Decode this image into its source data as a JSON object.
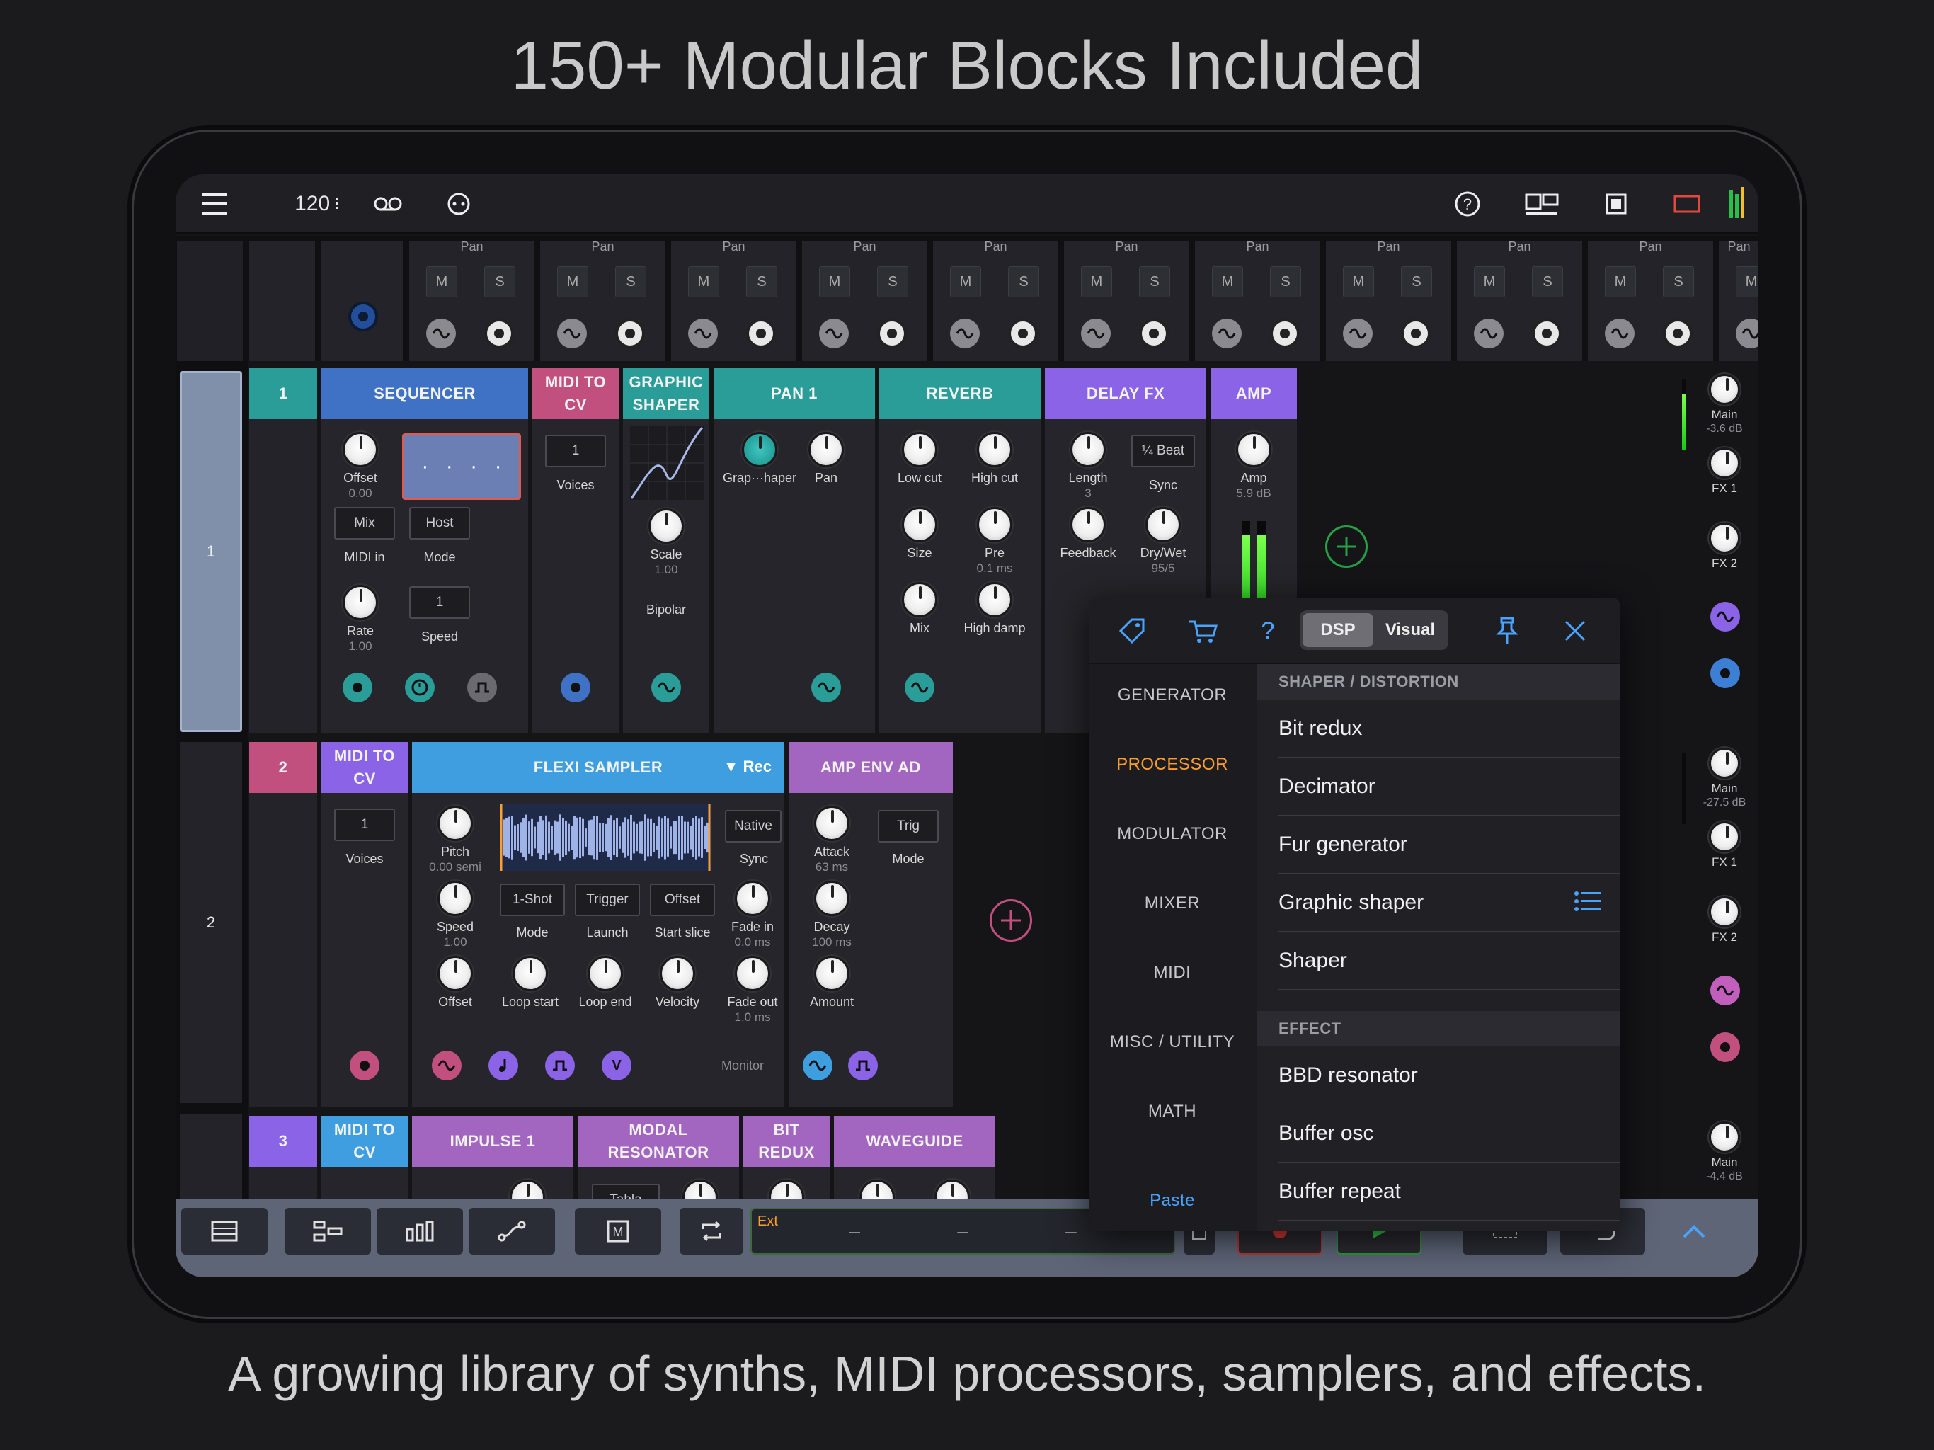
{
  "hero": {
    "title": "150+ Modular Blocks Included",
    "subtitle": "A growing library of synths, MIDI processors, samplers, and effects."
  },
  "topbar": {
    "tempo": "120",
    "tempo_suffix": "⁝"
  },
  "mixer": {
    "pan_label": "Pan",
    "mute_label": "M",
    "solo_label": "S",
    "strip_count": 11
  },
  "tracks": [
    {
      "number": "1"
    },
    {
      "number": "2"
    },
    {
      "number": "3"
    }
  ],
  "track1": {
    "lane_number": "1",
    "sequencer": {
      "title": "SEQUENCER",
      "offset_label": "Offset",
      "offset_value": "0.00",
      "mix_btn": "Mix",
      "midi_in_label": "MIDI in",
      "host_btn": "Host",
      "mode_label": "Mode",
      "rate_label": "Rate",
      "rate_value": "1.00",
      "speed_box": "1",
      "speed_label": "Speed"
    },
    "midi_to_cv": {
      "title": "MIDI TO CV",
      "voices_box": "1",
      "voices_label": "Voices"
    },
    "graphic_shaper": {
      "title": "GRAPHIC\nSHAPER",
      "scale_label": "Scale",
      "scale_value": "1.00",
      "bipolar_label": "Bipolar"
    },
    "pan": {
      "title": "PAN 1",
      "knob1_label": "Grap···haper",
      "knob2_label": "Pan"
    },
    "reverb": {
      "title": "REVERB",
      "low_cut": "Low cut",
      "high_cut": "High cut",
      "size": "Size",
      "pre": "Pre",
      "pre_value": "0.1 ms",
      "mix": "Mix",
      "high_damp": "High damp"
    },
    "delay": {
      "title": "DELAY FX",
      "length": "Length",
      "length_value": "3",
      "sync_box": "¼ Beat",
      "sync_label": "Sync",
      "feedback": "Feedback",
      "drywet": "Dry/Wet",
      "drywet_value": "95/5"
    },
    "amp": {
      "title": "AMP",
      "amp_label": "Amp",
      "amp_value": "5.9 dB"
    }
  },
  "track2": {
    "lane_number": "2",
    "midi_to_cv": {
      "title": "MIDI TO CV",
      "voices_box": "1",
      "voices_label": "Voices"
    },
    "sampler": {
      "title": "FLEXI SAMPLER",
      "rec": "▼ Rec",
      "pitch": "Pitch",
      "pitch_value": "0.00 semi",
      "native_box": "Native",
      "sync_label": "Sync",
      "speed": "Speed",
      "speed_value": "1.00",
      "oneshot_box": "1-Shot",
      "mode_label": "Mode",
      "trigger_box": "Trigger",
      "launch_label": "Launch",
      "offset_box": "Offset",
      "start_slice_label": "Start slice",
      "fade_in": "Fade in",
      "fade_in_value": "0.0 ms",
      "offset": "Offset",
      "loop_start": "Loop start",
      "loop_end": "Loop end",
      "velocity": "Velocity",
      "fade_out": "Fade out",
      "fade_out_value": "1.0 ms",
      "monitor": "Monitor"
    },
    "amp_env": {
      "title": "AMP ENV AD",
      "attack": "Attack",
      "attack_value": "63 ms",
      "trig_box": "Trig",
      "mode_label": "Mode",
      "decay": "Decay",
      "decay_value": "100 ms",
      "amount": "Amount"
    }
  },
  "track3": {
    "lane_number": "3",
    "modules": [
      "MIDI TO CV",
      "IMPULSE 1",
      "MODAL RESONATOR",
      "BIT REDUX",
      "WAVEGUIDE"
    ],
    "tabla_label": "Tabla"
  },
  "rightrail": [
    {
      "main_label": "Main",
      "main_value": "-3.6 dB",
      "fx1": "FX 1",
      "fx2": "FX 2"
    },
    {
      "main_label": "Main",
      "main_value": "-27.5 dB",
      "fx1": "FX 1",
      "fx2": "FX 2"
    },
    {
      "main_label": "Main",
      "main_value": "-4.4 dB"
    }
  ],
  "popup": {
    "seg_dsp": "DSP",
    "seg_visual": "Visual",
    "categories": [
      "GENERATOR",
      "PROCESSOR",
      "MODULATOR",
      "MIXER",
      "MIDI",
      "MISC / UTILITY",
      "MATH"
    ],
    "active_category": "PROCESSOR",
    "paste": "Paste",
    "section1": "SHAPER / DISTORTION",
    "section1_items": [
      "Bit redux",
      "Decimator",
      "Fur generator",
      "Graphic shaper",
      "Shaper"
    ],
    "section2": "EFFECT",
    "section2_items": [
      "BBD resonator",
      "Buffer osc",
      "Buffer repeat"
    ]
  },
  "bottombar": {
    "ext_label": "Ext"
  },
  "colors": {
    "teal": "#2a9d98",
    "blue": "#3f72c4",
    "pink": "#c2507f",
    "purple": "#8a63e6",
    "lilac": "#a266c0",
    "orange": "#ff9d2e",
    "accent": "#4aa3ff"
  }
}
